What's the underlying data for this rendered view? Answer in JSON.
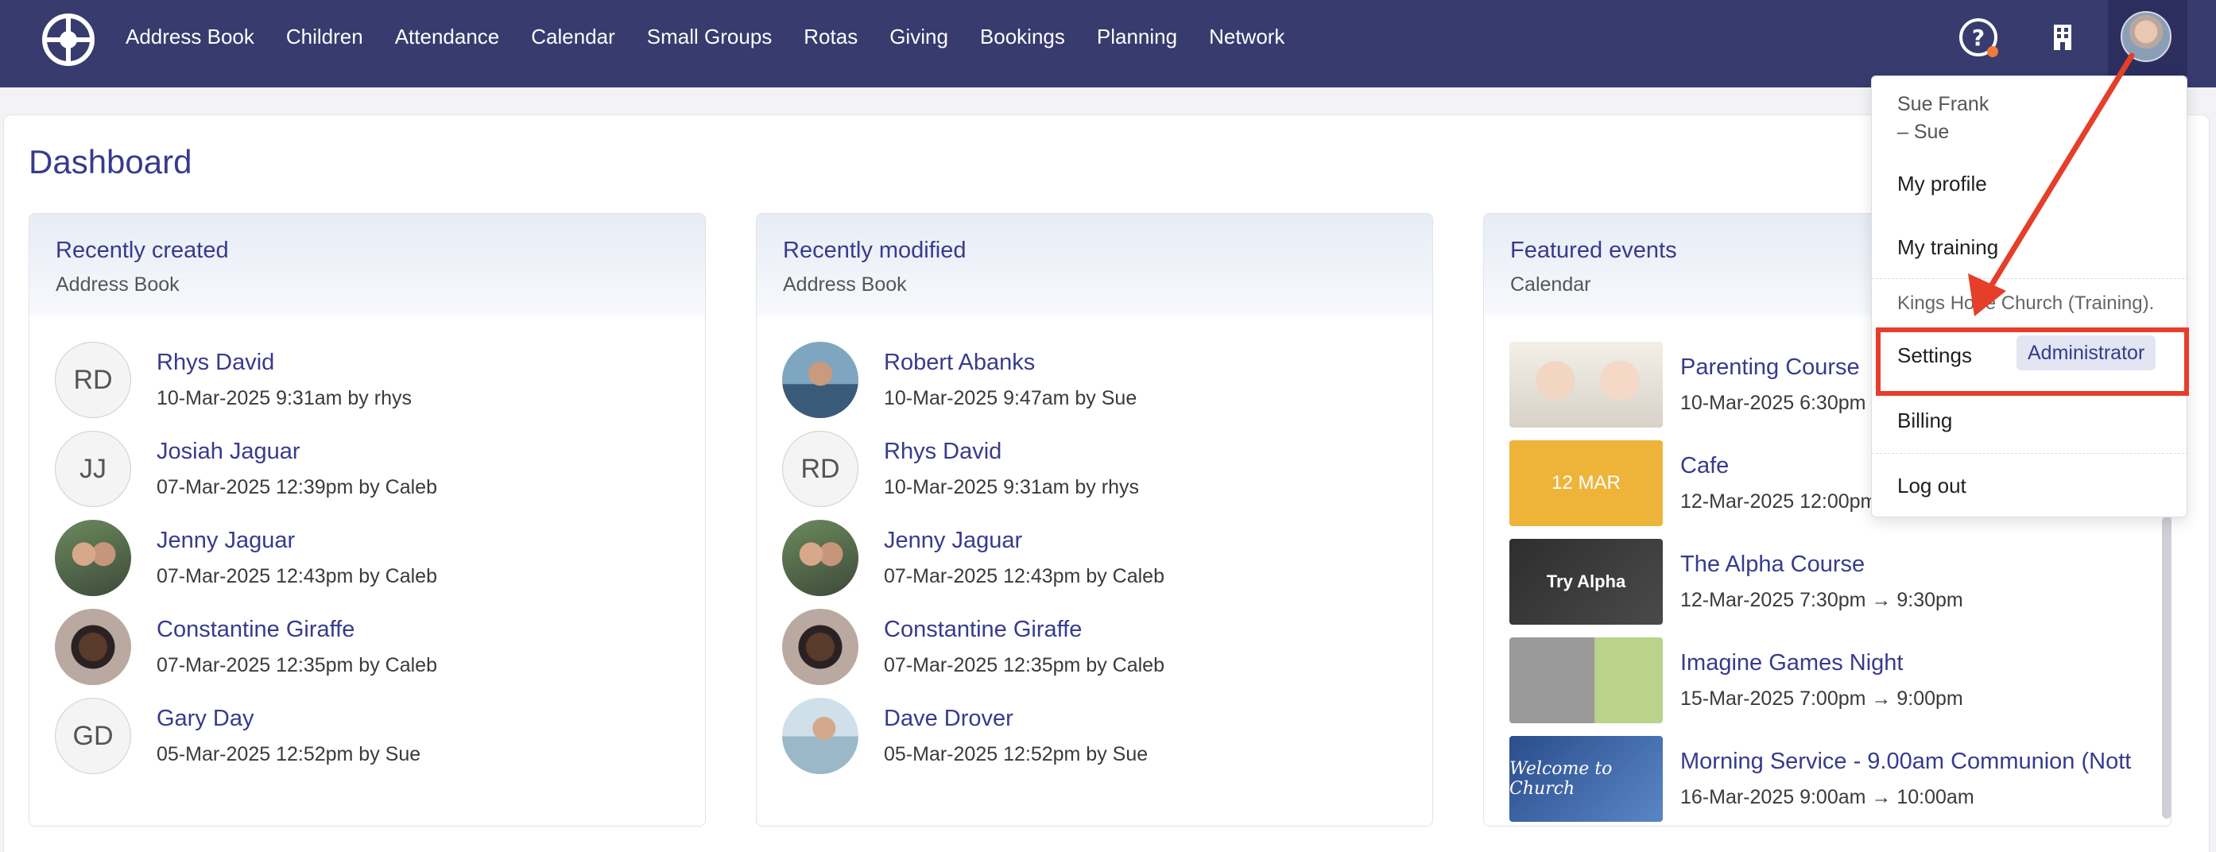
{
  "nav": {
    "items": [
      "Address Book",
      "Children",
      "Attendance",
      "Calendar",
      "Small Groups",
      "Rotas",
      "Giving",
      "Bookings",
      "Planning",
      "Network"
    ]
  },
  "page": {
    "title": "Dashboard"
  },
  "recently_created": {
    "title": "Recently created",
    "subtitle": "Address Book",
    "people": [
      {
        "initials": "RD",
        "name": "Rhys David",
        "meta": "10-Mar-2025 9:31am by rhys"
      },
      {
        "initials": "JJ",
        "name": "Josiah Jaguar",
        "meta": "07-Mar-2025 12:39pm by Caleb"
      },
      {
        "initials": "",
        "name": "Jenny Jaguar",
        "meta": "07-Mar-2025 12:43pm by Caleb"
      },
      {
        "initials": "",
        "name": "Constantine Giraffe",
        "meta": "07-Mar-2025 12:35pm by Caleb"
      },
      {
        "initials": "GD",
        "name": "Gary Day",
        "meta": "05-Mar-2025 12:52pm by Sue"
      }
    ]
  },
  "recently_modified": {
    "title": "Recently modified",
    "subtitle": "Address Book",
    "people": [
      {
        "initials": "",
        "name": "Robert Abanks",
        "meta": "10-Mar-2025 9:47am by Sue"
      },
      {
        "initials": "RD",
        "name": "Rhys David",
        "meta": "10-Mar-2025 9:31am by rhys"
      },
      {
        "initials": "",
        "name": "Jenny Jaguar",
        "meta": "07-Mar-2025 12:43pm by Caleb"
      },
      {
        "initials": "",
        "name": "Constantine Giraffe",
        "meta": "07-Mar-2025 12:35pm by Caleb"
      },
      {
        "initials": "",
        "name": "Dave Drover",
        "meta": "05-Mar-2025 12:52pm by Sue"
      }
    ]
  },
  "featured_events": {
    "title": "Featured events",
    "subtitle": "Calendar",
    "events": [
      {
        "thumb_text": "",
        "name": "Parenting Course",
        "meta": "10-Mar-2025 6:30pm"
      },
      {
        "thumb_text": "12 MAR",
        "name": "Cafe",
        "meta": "12-Mar-2025 12:00pm"
      },
      {
        "thumb_text": "Try Alpha",
        "name": "The Alpha Course",
        "meta": "12-Mar-2025 7:30pm → 9:30pm"
      },
      {
        "thumb_text": "",
        "name": "Imagine Games Night",
        "meta": "15-Mar-2025 7:00pm → 9:00pm"
      },
      {
        "thumb_text": "Welcome to Church",
        "name": "Morning Service - 9.00am Communion (Nott",
        "meta": "16-Mar-2025 9:00am → 10:00am"
      }
    ]
  },
  "user_menu": {
    "name": "Sue Frank",
    "nickname": "– Sue",
    "my_profile": "My profile",
    "my_training": "My training",
    "org": "Kings Hope Church (Training).",
    "settings": "Settings",
    "role_badge": "Administrator",
    "billing": "Billing",
    "logout": "Log out"
  },
  "colors": {
    "nav_bg": "#373b6e",
    "accent": "#373b8c",
    "highlight": "#e53e2a",
    "cafe_thumb": "#eeb43a"
  }
}
